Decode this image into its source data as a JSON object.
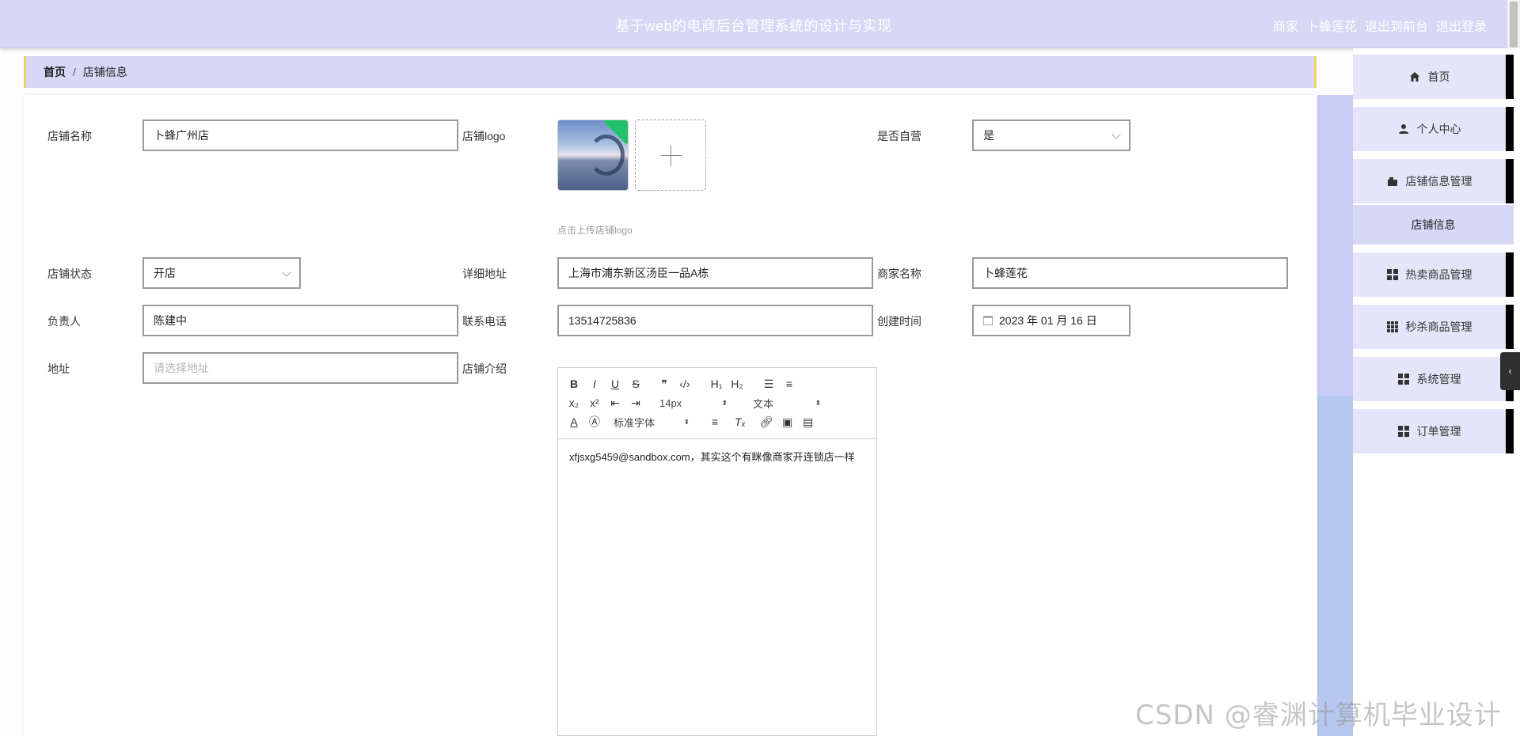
{
  "header": {
    "title": "基于web的电商后台管理系统的设计与实现",
    "role": "商家",
    "username": "卜蜂莲花",
    "to_front": "退出到前台",
    "logout": "退出登录"
  },
  "breadcrumb": {
    "home": "首页",
    "separator": "/",
    "current": "店铺信息"
  },
  "form": {
    "shop_name": {
      "label": "店铺名称",
      "value": "卜蜂广州店"
    },
    "shop_logo": {
      "label": "店铺logo",
      "hint": "点击上传店铺logo"
    },
    "self_operated": {
      "label": "是否自营",
      "value": "是"
    },
    "shop_status": {
      "label": "店铺状态",
      "value": "开店"
    },
    "detail_address": {
      "label": "详细地址",
      "value": "上海市浦东新区汤臣一品A栋"
    },
    "merchant_name": {
      "label": "商家名称",
      "value": "卜蜂莲花"
    },
    "manager": {
      "label": "负责人",
      "value": "陈建中"
    },
    "phone": {
      "label": "联系电话",
      "value": "13514725836"
    },
    "created_time": {
      "label": "创建时间",
      "value": "2023 年 01 月 16 日"
    },
    "address": {
      "label": "地址",
      "placeholder": "请选择地址"
    },
    "intro": {
      "label": "店铺介绍",
      "content": "xfjsxg5459@sandbox.com，其实这个有眯像商家开连锁店一样"
    }
  },
  "editor_toolbar": {
    "font_size": "14px",
    "heading": "文本",
    "font_family": "标准字体"
  },
  "sidebar": {
    "items": [
      {
        "label": "首页",
        "icon": "home-icon"
      },
      {
        "label": "个人中心",
        "icon": "user-icon"
      },
      {
        "label": "店铺信息管理",
        "icon": "shop-icon"
      },
      {
        "label": "店铺信息",
        "sub": true
      },
      {
        "label": "热卖商品管理",
        "icon": "grid-icon"
      },
      {
        "label": "秒杀商品管理",
        "icon": "grid-icon"
      },
      {
        "label": "系统管理",
        "icon": "grid-icon"
      },
      {
        "label": "订单管理",
        "icon": "grid-icon"
      }
    ]
  },
  "watermark": "CSDN @睿渊计算机毕业设计",
  "colors": {
    "header_bg": "#d6d8f6",
    "breadcrumb_border": "#f2cf6a",
    "menu_bg": "#e4e5f8"
  }
}
